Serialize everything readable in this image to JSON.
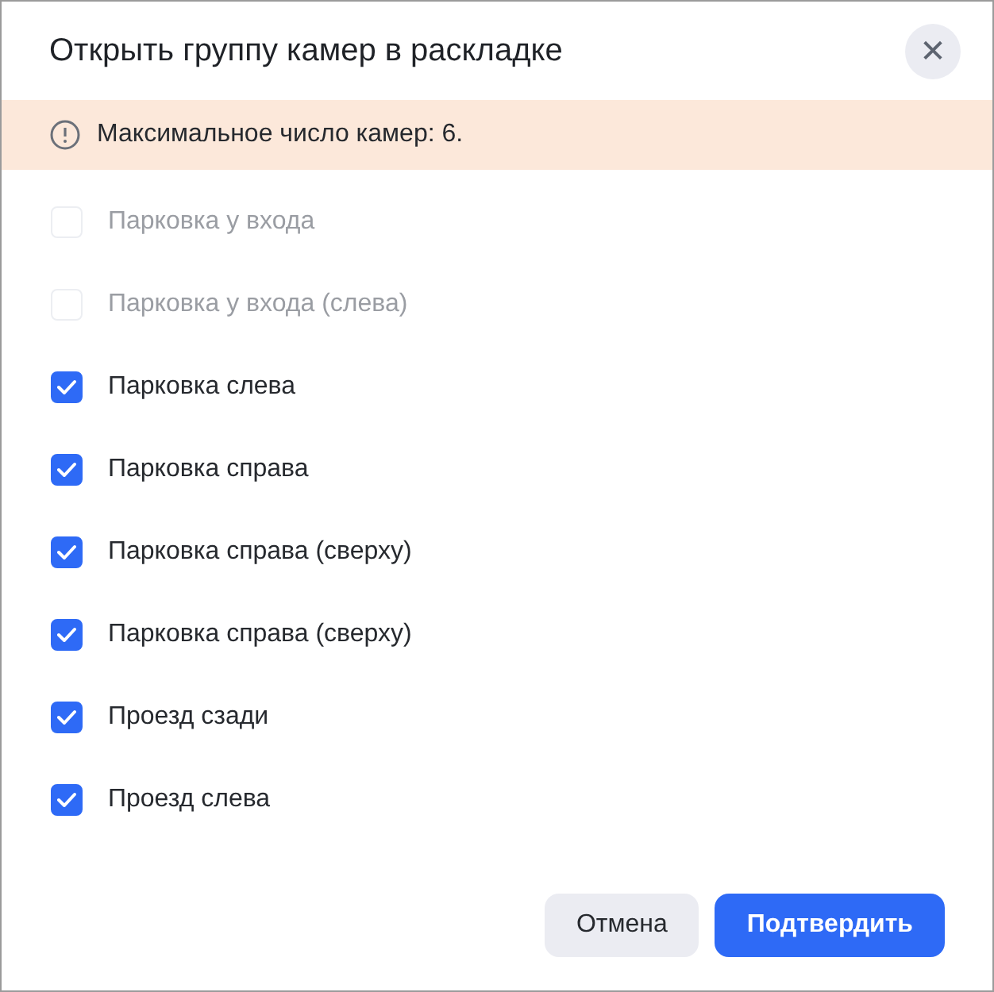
{
  "dialog": {
    "title": "Открыть группу камер в раскладке",
    "close": "✕"
  },
  "notice": {
    "text": "Максимальное число камер: 6."
  },
  "cameras": [
    {
      "label": "Парковка у входа",
      "checked": false,
      "disabled": true
    },
    {
      "label": "Парковка у входа (слева)",
      "checked": false,
      "disabled": true
    },
    {
      "label": "Парковка слева",
      "checked": true,
      "disabled": false
    },
    {
      "label": "Парковка справа",
      "checked": true,
      "disabled": false
    },
    {
      "label": "Парковка справа (сверху)",
      "checked": true,
      "disabled": false
    },
    {
      "label": "Парковка справа (сверху)",
      "checked": true,
      "disabled": false
    },
    {
      "label": "Проезд сзади",
      "checked": true,
      "disabled": false
    },
    {
      "label": "Проезд слева",
      "checked": true,
      "disabled": false
    }
  ],
  "buttons": [
    {
      "label": "Отмена",
      "kind": "secondary"
    },
    {
      "label": "Подтвердить",
      "kind": "primary"
    }
  ]
}
